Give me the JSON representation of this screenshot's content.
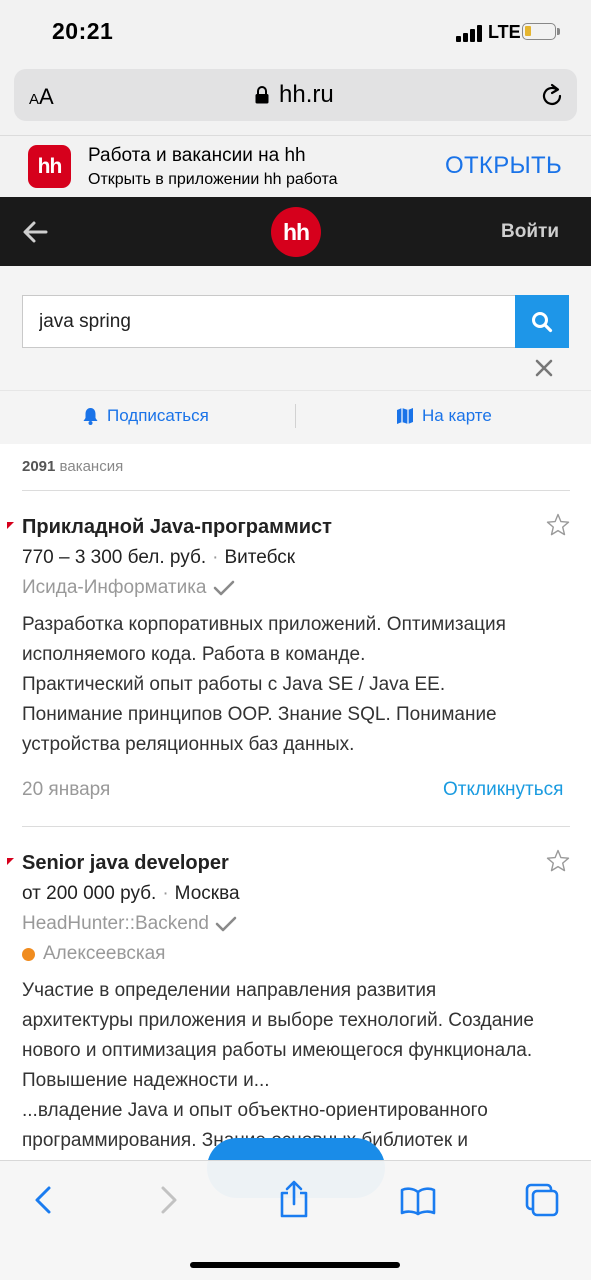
{
  "status_bar": {
    "time": "20:21",
    "network": "LTE"
  },
  "safari": {
    "text_size_label_small": "A",
    "text_size_label_big": "A",
    "url": "hh.ru"
  },
  "smart_banner": {
    "logo_text": "hh",
    "title": "Работа и вакансии на hh",
    "subtitle": "Открыть в приложении hh работа",
    "open_label": "ОТКРЫТЬ"
  },
  "header": {
    "logo_text": "hh",
    "login_label": "Войти"
  },
  "search": {
    "query": "java spring"
  },
  "actions": {
    "subscribe_label": "Подписаться",
    "map_label": "На карте"
  },
  "results": {
    "count_number": "2091",
    "count_word": "вакансия"
  },
  "vacancies": [
    {
      "title": "Прикладной Java-программист",
      "salary": "770 – 3 300  бел. руб.",
      "city": "Витебск",
      "company": "Исида-Информатика",
      "desc_line1": "Разработка корпоративных приложений. Оптимизация",
      "desc_line2": "исполняемого кода. Работа в команде.",
      "desc_line3": "Практический опыт работы с Java SE / Java EE.",
      "desc_line4": "Понимание принципов OOP. Знание SQL. Понимание",
      "desc_line5": "устройства реляционных баз данных.",
      "date": "20 января",
      "respond_label": "Откликнуться"
    },
    {
      "title": "Senior java developer",
      "salary": "от 200 000 руб.",
      "city": "Москва",
      "company": "HeadHunter::Backend",
      "metro": "Алексеевская",
      "metro_color": "#f08c1f",
      "desc_line1": "Участие в определении направления развития",
      "desc_line2": "архитектуры приложения и выборе технологий. Создание",
      "desc_line3": "нового и оптимизация работы имеющегося функционала.",
      "desc_line4": "Повышение надежности и...",
      "desc_line5": "...владение Java и опыт объектно-ориентированного",
      "desc_line6": "программирования. Знание основных библиотек и"
    }
  ],
  "colors": {
    "brand_red": "#d6001c",
    "link_blue": "#1a73e8",
    "search_blue": "#1e96e8"
  },
  "toolbar_icons": [
    "back-icon",
    "forward-icon",
    "share-icon",
    "bookmarks-icon",
    "tabs-icon"
  ]
}
